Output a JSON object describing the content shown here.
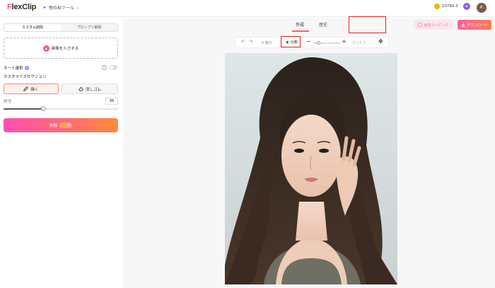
{
  "header": {
    "logo_first": "F",
    "logo_rest": "lexClip",
    "tools_menu": "他のAIツール",
    "credits": "10782.3",
    "avatar_initial": "K"
  },
  "left_panel": {
    "tabs": [
      {
        "label": "カスタム削除",
        "active": true
      },
      {
        "label": "プロンプト削除",
        "active": false
      }
    ],
    "upload_label": "画像を入力する",
    "auto_select_label": "オート選択",
    "auto_select_enabled": false,
    "custom_section_label": "カスタマイズセクション",
    "draw_label": "描く",
    "eraser_label": "消しゴム",
    "size_label": "尺寸",
    "size_value": "36",
    "size_fraction": 0.35,
    "remove_label": "削除",
    "remove_cost": "4"
  },
  "main": {
    "tabs": [
      {
        "label": "作成",
        "active": true
      },
      {
        "label": "歴史",
        "active": false
      }
    ],
    "bg_change_label": "画像ラッピング",
    "download_label": "ダウンロード",
    "toolbar": {
      "reset_label": "復元",
      "compare_label": "比較",
      "fit_label": "ぴったり",
      "zoom_fraction": 0.2
    }
  },
  "colors": {
    "accent_pink": "#ff4fb1",
    "accent_orange": "#ff8a3d",
    "highlight_red": "#e0261f"
  }
}
